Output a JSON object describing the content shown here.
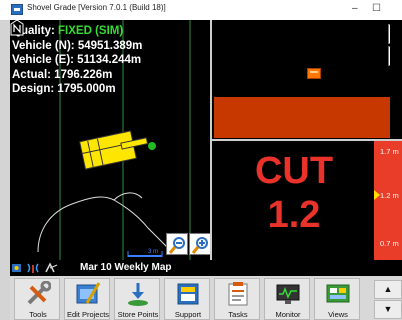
{
  "window": {
    "title": "Shovel Grade [Version 7.0.1 (Build 18)]",
    "minimize_glyph": "–",
    "maximize_glyph": "☐"
  },
  "readout": {
    "quality_label": "Quality:",
    "quality_value": "FIXED (SIM)",
    "vehicle_n": "Vehicle (N): 54951.389m",
    "vehicle_e": "Vehicle (E): 51134.244m",
    "actual": "Actual: 1796.226m",
    "design": "Design: 1795.000m"
  },
  "map": {
    "scale_label": "3 m"
  },
  "grade": {
    "label": "CUT",
    "value": "1.2",
    "bar_top": "1.7 m",
    "bar_mid": "1.2 m",
    "bar_bottom": "0.7 m"
  },
  "status": {
    "map_name": "Mar 10 Weekly Map"
  },
  "toolbar": {
    "tools": "Tools",
    "edit_projects": "Edit Projects",
    "store_points": "Store Points",
    "support": "Support",
    "tasks": "Tasks",
    "monitor": "Monitor",
    "views": "Views",
    "up": "▲",
    "down": "▼"
  },
  "colors": {
    "fixed_green": "#33dd33",
    "cut_red": "#e8322a",
    "cut_strip": "#c63800",
    "bar_red": "#e93d2a"
  }
}
